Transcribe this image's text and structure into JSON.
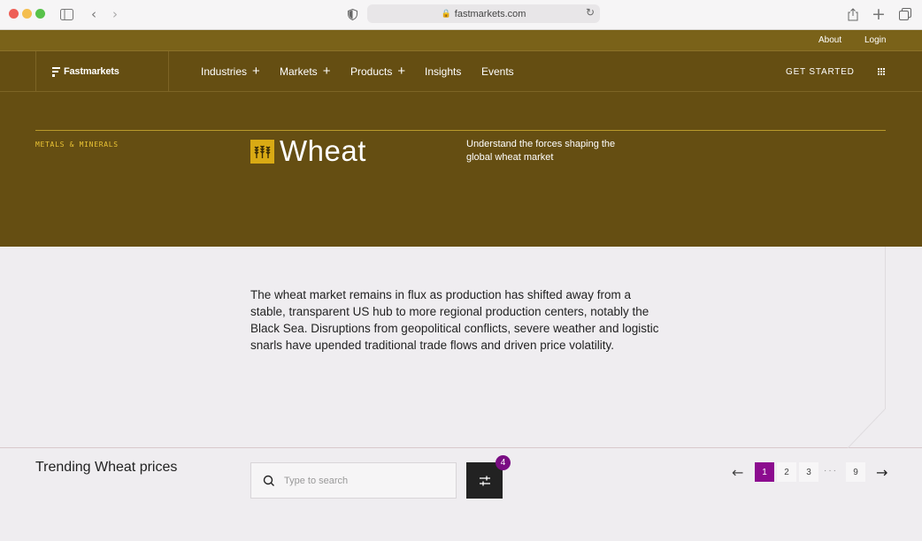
{
  "browser": {
    "url": "fastmarkets.com"
  },
  "utility_nav": {
    "about": "About",
    "login": "Login"
  },
  "main_nav": {
    "logo": "Fastmarkets",
    "items": [
      {
        "label": "Industries",
        "has_menu": true
      },
      {
        "label": "Markets",
        "has_menu": true
      },
      {
        "label": "Products",
        "has_menu": true
      },
      {
        "label": "Insights",
        "has_menu": false
      },
      {
        "label": "Events",
        "has_menu": false
      }
    ],
    "cta": "GET STARTED"
  },
  "hero": {
    "category": "METALS & MINERALS",
    "title": "Wheat",
    "tagline": "Understand the forces shaping the global wheat market"
  },
  "intro": {
    "text": "The wheat market remains in flux as production has shifted away from a stable, transparent US hub to more regional production centers, notably the Black Sea. Disruptions from geopolitical conflicts, severe weather and logistic snarls have upended traditional trade flows and driven price volatility."
  },
  "trending": {
    "title": "Trending Wheat prices",
    "search_placeholder": "Type to search",
    "filter_count": "4"
  },
  "pagination": {
    "pages": [
      "1",
      "2",
      "3"
    ],
    "ellipsis": "···",
    "last": "9",
    "current": "1"
  },
  "colors": {
    "hero_bg": "#654e12",
    "accent_yellow": "#eac334",
    "pager_active": "#8c0c8f",
    "badge": "#7a0d83"
  }
}
